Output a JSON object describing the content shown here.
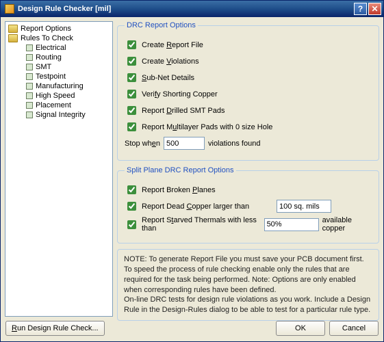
{
  "window": {
    "title": "Design Rule Checker [mil]"
  },
  "tree": {
    "root1": "Report Options",
    "root2": "Rules To Check",
    "children": [
      "Electrical",
      "Routing",
      "SMT",
      "Testpoint",
      "Manufacturing",
      "High Speed",
      "Placement",
      "Signal Integrity"
    ]
  },
  "drc": {
    "legend": "DRC Report Options",
    "opt1": "Create Report File",
    "opt2": "Create Violations",
    "opt3": "Sub-Net Details",
    "opt4": "Verify Shorting Copper",
    "opt5": "Report Drilled SMT Pads",
    "opt6": "Report Multilayer Pads with 0 size Hole",
    "stop_prefix": "Stop when",
    "stop_value": "500",
    "stop_suffix": "violations found"
  },
  "split": {
    "legend": "Split Plane DRC Report Options",
    "opt1": "Report Broken Planes",
    "opt2": "Report Dead Copper larger than",
    "opt2_value": "100 sq. mils",
    "opt3": "Report Starved Thermals with less than",
    "opt3_value": "50%",
    "opt3_suffix": "available copper"
  },
  "notes": {
    "l1": "NOTE: To generate Report File you must save your PCB document first.",
    "l2": "To speed the process of rule checking enable only the rules that are required for the task being performed.  Note: Options are only enabled when corresponding rules have been defined.",
    "l3": "On-line DRC tests for design rule violations as you work. Include a Design Rule in the Design-Rules dialog to be able to test for a particular rule  type."
  },
  "buttons": {
    "run": "Run Design Rule Check...",
    "ok": "OK",
    "cancel": "Cancel"
  }
}
